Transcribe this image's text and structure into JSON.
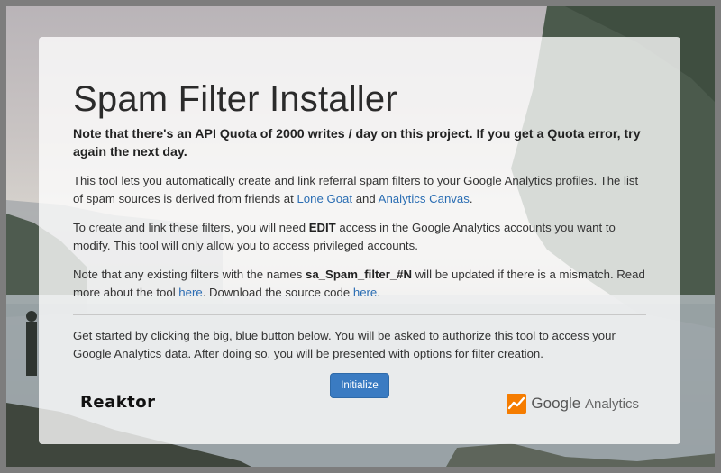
{
  "page": {
    "title": "Spam Filter Installer",
    "quota_notice": "Note that there's an API Quota of 2000 writes / day on this project. If you get a Quota error, try again the next day."
  },
  "intro": {
    "text_before": "This tool lets you automatically create and link referral spam filters to your Google Analytics profiles. The list of spam sources is derived from friends at ",
    "link1": "Lone Goat",
    "text_between": " and ",
    "link2": "Analytics Canvas",
    "text_after": "."
  },
  "access": {
    "text_before": "To create and link these filters, you will need ",
    "emphasis": "EDIT",
    "text_after": " access in the Google Analytics accounts you want to modify. This tool will only allow you to access privileged accounts."
  },
  "filters_note": {
    "text_before": "Note that any existing filters with the names ",
    "filter_name": "sa_Spam_filter_#N",
    "text_middle": " will be updated if there is a mismatch. Read more about the tool ",
    "link_tool": "here",
    "text_download": ". Download the source code ",
    "link_source": "here",
    "text_after": "."
  },
  "get_started": {
    "text": "Get started by clicking the big, blue button below. You will be asked to authorize this tool to access your Google Analytics data. After doing so, you will be presented with options for filter creation."
  },
  "actions": {
    "initialize_label": "Initialize"
  },
  "logos": {
    "reaktor": "Reaktor",
    "google": "Google",
    "analytics": "Analytics",
    "ga_icon": "google-analytics-icon"
  },
  "colors": {
    "link": "#2a6db3",
    "button": "#3a7bc2",
    "ga_orange": "#f57c00"
  }
}
